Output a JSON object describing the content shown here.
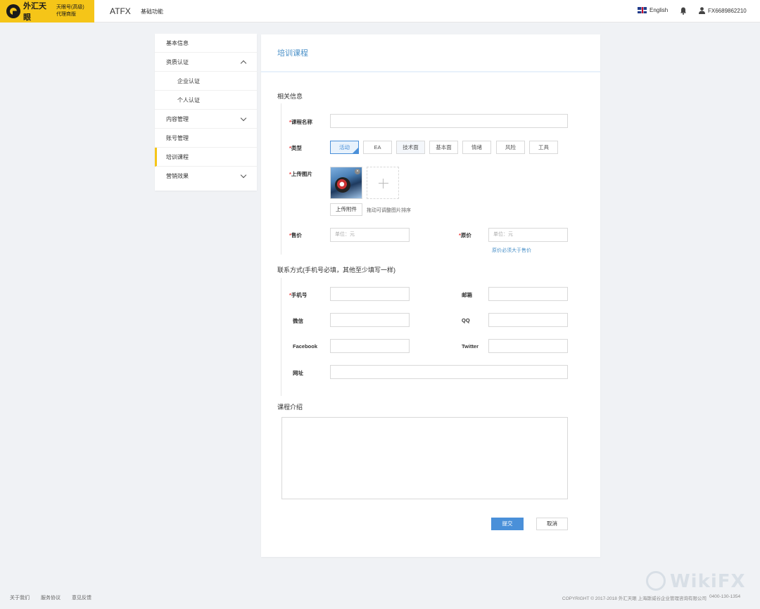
{
  "topbar": {
    "brand_name": "外汇天眼",
    "brand_sub_line1": "天眼号(高级)",
    "brand_sub_line2": "代理商版",
    "app_title": "ATFX",
    "nav_label": "基础功能",
    "language": "English",
    "username": "FX6689862210"
  },
  "sidebar": {
    "items": [
      {
        "label": "基本信息"
      },
      {
        "label": "资质认证"
      },
      {
        "label": "企业认证"
      },
      {
        "label": "个人认证"
      },
      {
        "label": "内容管理"
      },
      {
        "label": "账号管理"
      },
      {
        "label": "培训课程"
      },
      {
        "label": "营销效果"
      }
    ]
  },
  "panel": {
    "title": "培训课程",
    "section_info": "相关信息",
    "course_name_label": "课程名称",
    "type_label": "类型",
    "types": [
      "活动",
      "EA",
      "技术面",
      "基本面",
      "情绪",
      "风险",
      "工具"
    ],
    "upload_label": "上传图片",
    "upload_button": "上传附件",
    "upload_hint": "拖动可调整图片排序",
    "price_label": "售价",
    "price_placeholder": "单位：元",
    "orig_price_label": "原价",
    "orig_price_placeholder": "单位：元",
    "orig_price_hint": "原价必须大于售价",
    "section_contact": "联系方式(手机号必填，其他至少填写一样)",
    "phone_label": "手机号",
    "email_label": "邮箱",
    "wechat_label": "微信",
    "qq_label": "QQ",
    "facebook_label": "Facebook",
    "twitter_label": "Twitter",
    "website_label": "网址",
    "section_intro": "课程介绍",
    "submit": "提交",
    "cancel": "取消"
  },
  "footer": {
    "links": [
      "关于我们",
      "服务协议",
      "意见反馈"
    ],
    "copyright": "COPYRIGHT © 2017-2018 外汇天眼  上海斯威谷企业管理咨询有限公司",
    "phone": "0400-130-1354",
    "watermark": "WikiFX"
  },
  "colors": {
    "brand_yellow": "#f5c518",
    "accent_blue": "#4a90d9",
    "required_red": "#e33"
  }
}
